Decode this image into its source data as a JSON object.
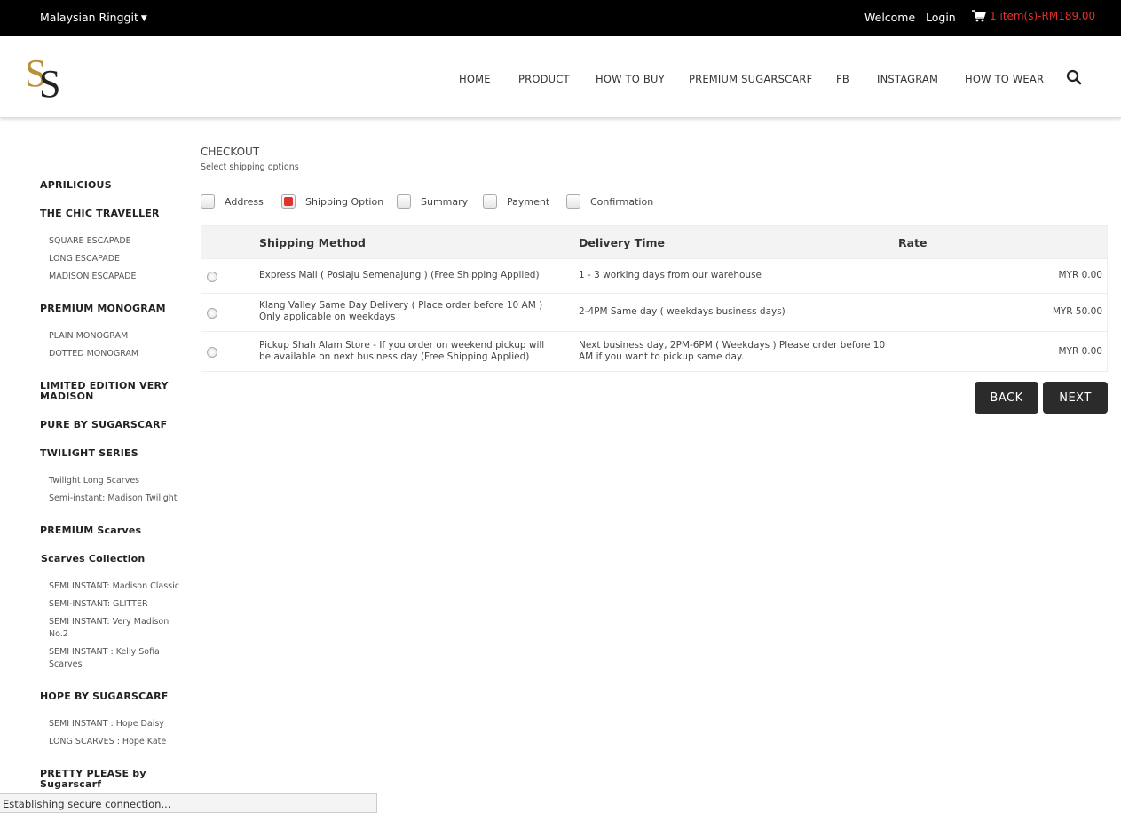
{
  "topbar": {
    "currency": "Malaysian Ringgit",
    "welcome": "Welcome",
    "login": "Login",
    "cart": "1 item(s)-RM189.00"
  },
  "nav": [
    "HOME",
    "PRODUCT",
    "HOW TO BUY",
    "PREMIUM SUGARSCARF",
    "FB",
    "INSTAGRAM",
    "HOW TO WEAR"
  ],
  "sidebar": {
    "categories": [
      {
        "label": "APRILICIOUS",
        "subs": []
      },
      {
        "label": "THE CHIC TRAVELLER",
        "subs": [
          "SQUARE ESCAPADE",
          "LONG ESCAPADE",
          "MADISON ESCAPADE"
        ]
      },
      {
        "label": "PREMIUM MONOGRAM",
        "subs": [
          "PLAIN MONOGRAM",
          "DOTTED MONOGRAM"
        ]
      },
      {
        "label": "LIMITED EDITION VERY MADISON",
        "subs": []
      },
      {
        "label": "PURE BY SUGARSCARF",
        "subs": []
      },
      {
        "label": "TWILIGHT SERIES",
        "subs": [
          "Twilight Long Scarves",
          "Semi-instant: Madison Twilight"
        ]
      },
      {
        "label": "PREMIUM Scarves",
        "subs": []
      },
      {
        "label": "Scarves Collection",
        "subs": [
          "SEMI INSTANT: Madison Classic",
          "SEMI-INSTANT: GLITTER",
          "SEMI INSTANT: Very Madison No.2",
          "SEMI INSTANT : Kelly Sofia Scarves"
        ]
      },
      {
        "label": "HOPE BY SUGARSCARF",
        "subs": [
          "SEMI INSTANT : Hope Daisy",
          "LONG SCARVES : Hope Kate"
        ]
      },
      {
        "label": "PRETTY PLEASE by Sugarscarf",
        "subs": []
      }
    ]
  },
  "checkout": {
    "title": "CHECKOUT",
    "subtitle": "Select shipping options",
    "steps": [
      {
        "label": "Address",
        "active": false
      },
      {
        "label": "Shipping Option",
        "active": true
      },
      {
        "label": "Summary",
        "active": false
      },
      {
        "label": "Payment",
        "active": false
      },
      {
        "label": "Confirmation",
        "active": false
      }
    ],
    "table": {
      "headers": {
        "method": "Shipping Method",
        "time": "Delivery Time",
        "rate": "Rate"
      },
      "rows": [
        {
          "method": "Express Mail ( Poslaju Semenajung ) (Free Shipping Applied)",
          "time": "1 - 3 working days from our warehouse",
          "rate": "MYR 0.00"
        },
        {
          "method": "Klang Valley Same Day Delivery ( Place order before 10 AM ) Only applicable on weekdays",
          "time": "2-4PM Same day ( weekdays business days)",
          "rate": "MYR 50.00"
        },
        {
          "method": "Pickup Shah Alam Store - If you order on weekend pickup will be available on next business day (Free Shipping Applied)",
          "time": "Next business day, 2PM-6PM ( Weekdays ) Please order before 10 AM if you want to pickup same day.",
          "rate": "MYR 0.00"
        }
      ]
    },
    "back_label": "BACK",
    "next_label": "NEXT"
  },
  "status": "Establishing secure connection..."
}
